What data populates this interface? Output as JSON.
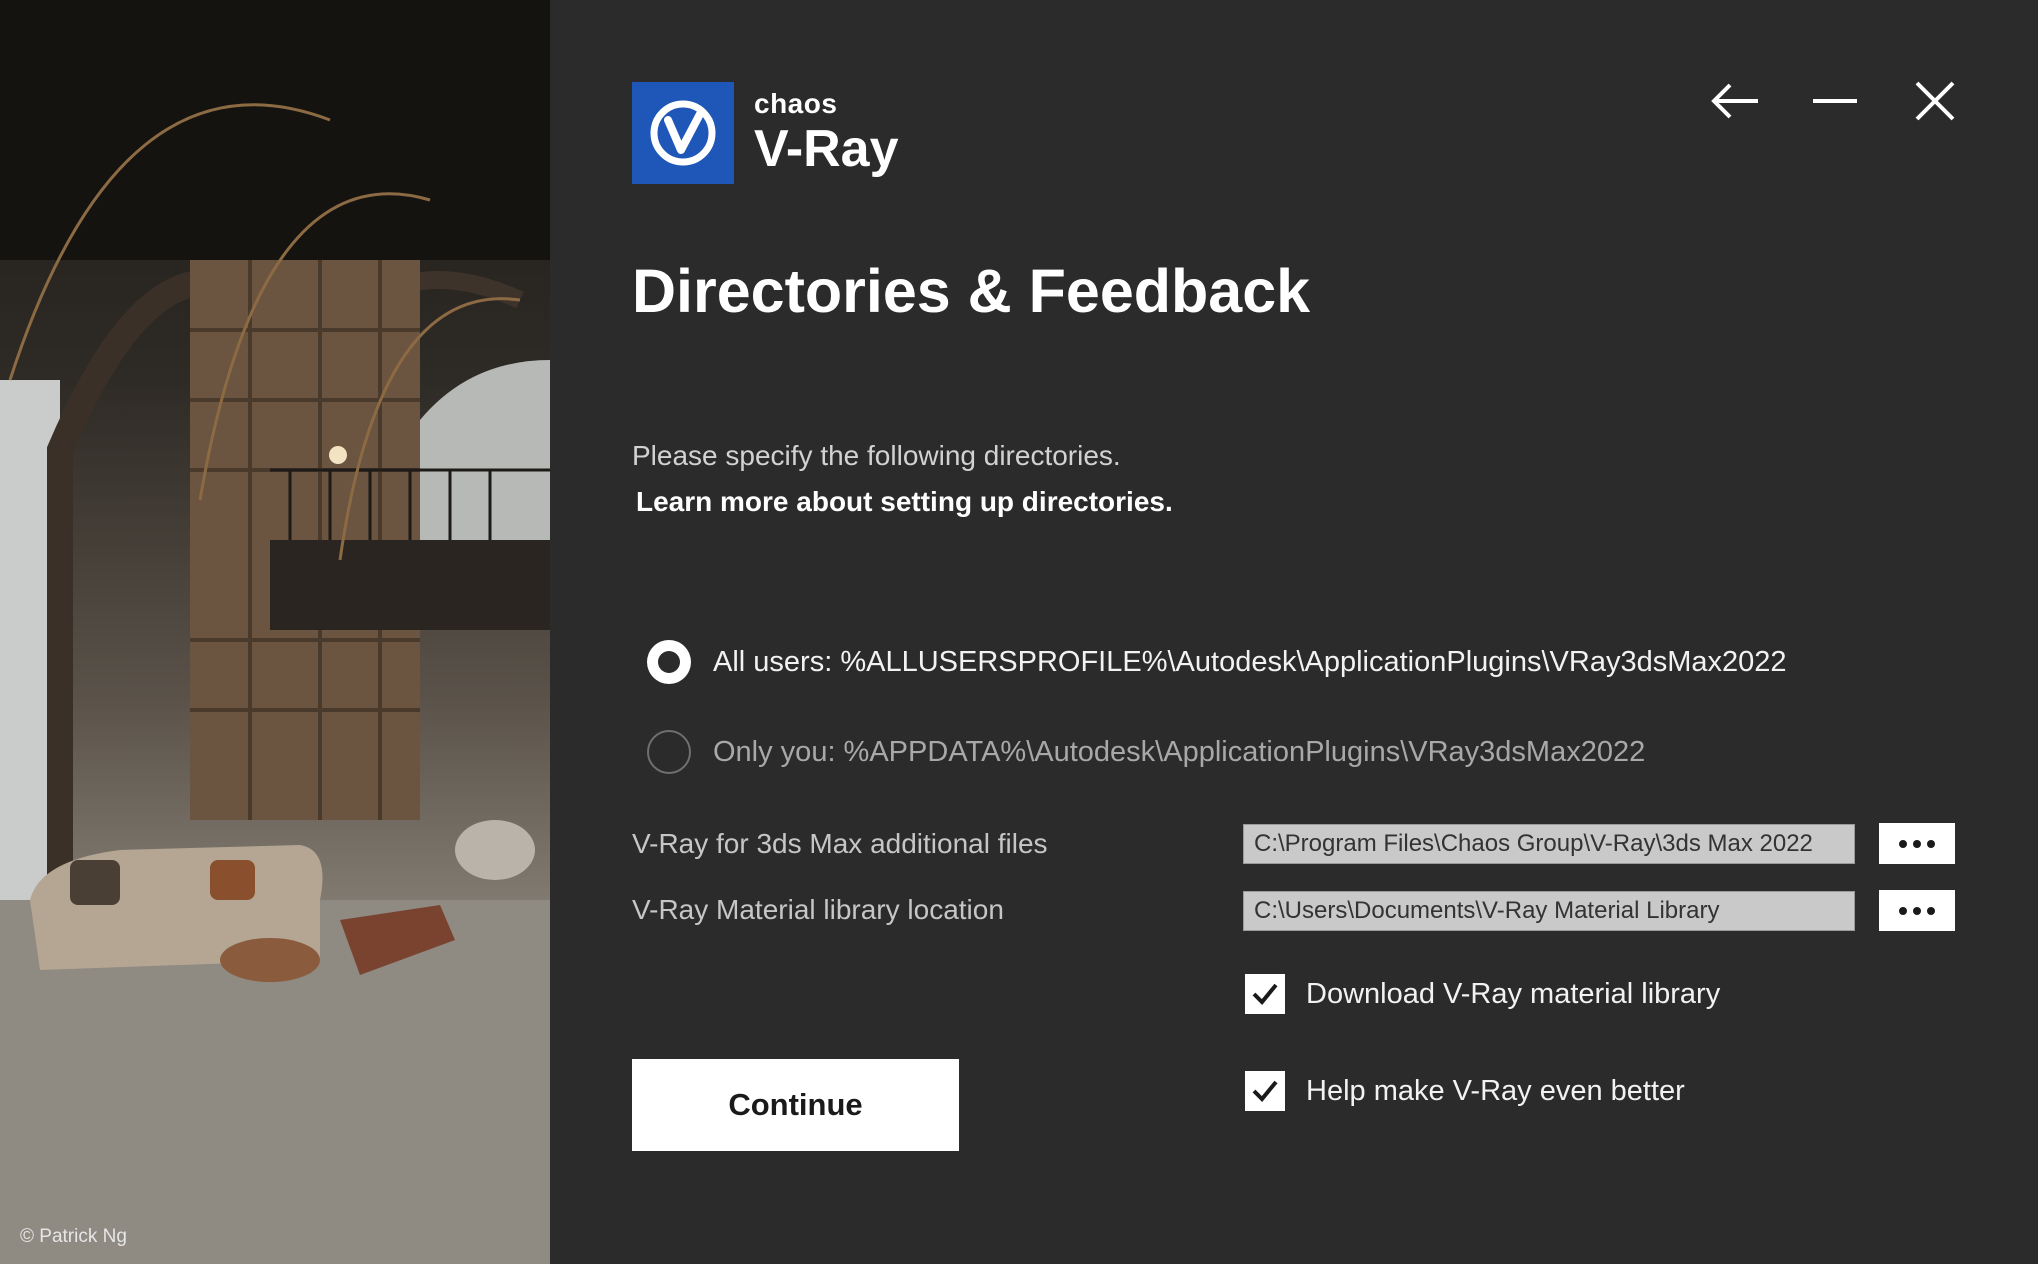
{
  "photo": {
    "credit": "© Patrick Ng"
  },
  "logo": {
    "brand": "chaos",
    "product": "V-Ray",
    "icon": "vray-logo-icon",
    "color": "#1f57b8"
  },
  "window_controls": {
    "back_icon": "arrow-left-icon",
    "minimize_icon": "minimize-icon",
    "close_icon": "close-icon"
  },
  "page": {
    "title": "Directories & Feedback",
    "intro": "Please specify the following directories.",
    "learn_more": "Learn more about setting up directories."
  },
  "install_scope": {
    "options": [
      {
        "label": "All users: %ALLUSERSPROFILE%\\Autodesk\\ApplicationPlugins\\VRay3dsMax2022",
        "selected": true
      },
      {
        "label": "Only you: %APPDATA%\\Autodesk\\ApplicationPlugins\\VRay3dsMax2022",
        "selected": false
      }
    ]
  },
  "fields": [
    {
      "label": "V-Ray for 3ds Max additional files",
      "value": "C:\\Program Files\\Chaos Group\\V-Ray\\3ds Max 2022",
      "browse_icon": "ellipsis-icon"
    },
    {
      "label": "V-Ray Material library location",
      "value": "C:\\Users\\Documents\\V-Ray Material Library",
      "browse_icon": "ellipsis-icon"
    }
  ],
  "checkboxes": [
    {
      "label": "Download V-Ray material library",
      "checked": true
    },
    {
      "label": "Help make V-Ray even better",
      "checked": true
    }
  ],
  "continue_label": "Continue",
  "colors": {
    "background": "#2b2b2b",
    "accent": "#1f57b8",
    "input_bg": "#c9c9c9"
  }
}
